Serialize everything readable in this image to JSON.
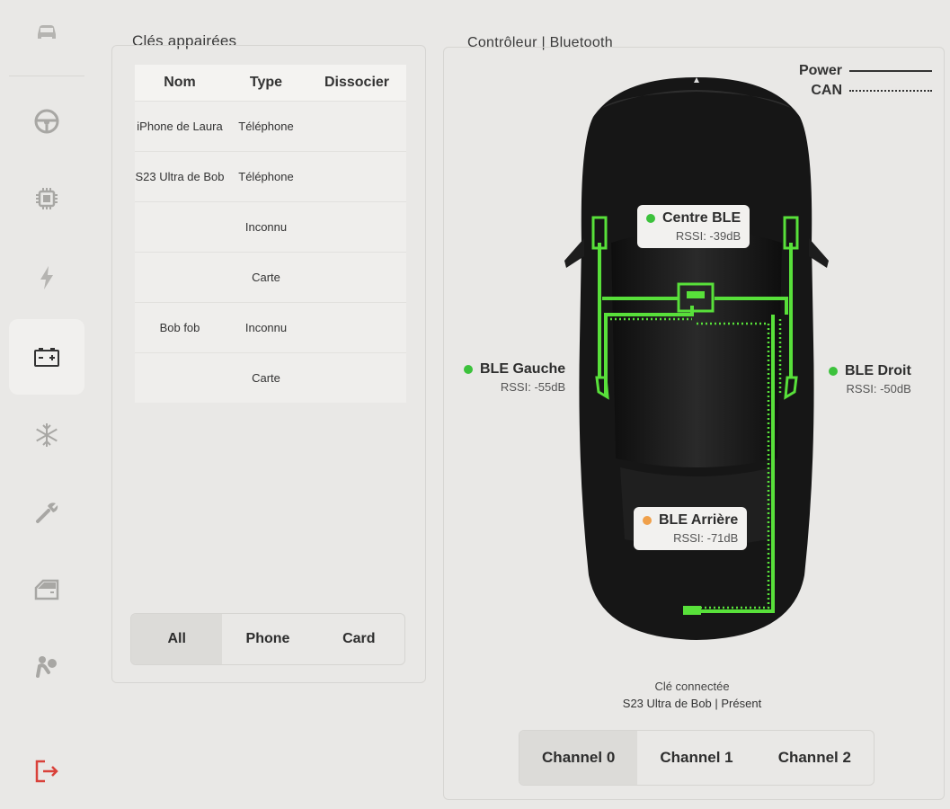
{
  "sidebar": {
    "items": [
      {
        "icon": "car-icon",
        "active": false
      },
      {
        "icon": "steering-wheel-icon",
        "active": false
      },
      {
        "icon": "chip-icon",
        "active": false
      },
      {
        "icon": "lightning-icon",
        "active": false
      },
      {
        "icon": "battery-icon",
        "active": true
      },
      {
        "icon": "snowflake-icon",
        "active": false
      },
      {
        "icon": "wrench-icon",
        "active": false
      },
      {
        "icon": "door-icon",
        "active": false
      },
      {
        "icon": "airbag-icon",
        "active": false
      },
      {
        "icon": "logout-icon",
        "active": false,
        "color": "#d9413a"
      }
    ]
  },
  "keys": {
    "title": "Clés appairées",
    "headers": {
      "name": "Nom",
      "type": "Type",
      "dissociate": "Dissocier"
    },
    "rows": [
      {
        "name": "iPhone de Laura",
        "type": "Téléphone"
      },
      {
        "name": "S23 Ultra de Bob",
        "type": "Téléphone"
      },
      {
        "name": "",
        "type": "Inconnu"
      },
      {
        "name": "",
        "type": "Carte"
      },
      {
        "name": "Bob fob",
        "type": "Inconnu"
      },
      {
        "name": "",
        "type": "Carte"
      }
    ],
    "filters": [
      {
        "label": "All",
        "active": true
      },
      {
        "label": "Phone",
        "active": false
      },
      {
        "label": "Card",
        "active": false
      }
    ]
  },
  "controller": {
    "title": "Contrôleur | Bluetooth",
    "legend": {
      "power": "Power",
      "can": "CAN"
    },
    "ble": {
      "center": {
        "name": "Centre BLE",
        "rssi": "RSSI: -39dB",
        "status_color": "#3cc23c"
      },
      "left": {
        "name": "BLE Gauche",
        "rssi": "RSSI: -55dB",
        "status_color": "#3cc23c"
      },
      "right": {
        "name": "BLE Droit",
        "rssi": "RSSI: -50dB",
        "status_color": "#3cc23c"
      },
      "rear": {
        "name": "BLE Arrière",
        "rssi": "RSSI: -71dB",
        "status_color": "#f0a04a"
      }
    },
    "connected_label": "Clé connectée",
    "connected_value": "S23 Ultra de Bob | Présent",
    "channels": [
      {
        "label": "Channel 0",
        "active": true
      },
      {
        "label": "Channel 1",
        "active": false
      },
      {
        "label": "Channel 2",
        "active": false
      }
    ]
  },
  "colors": {
    "wiring": "#58e03a",
    "accent_logout": "#d9413a",
    "background": "#e9e8e6"
  }
}
